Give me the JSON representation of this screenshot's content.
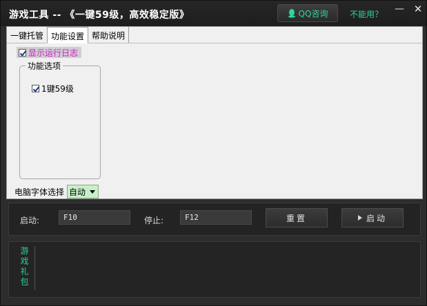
{
  "window": {
    "title": "游戏工具 -- 《一键59级，高效稳定版》",
    "qq_button": "QQ咨询",
    "unusable_link": "不能用？",
    "minimize_glyph": "—",
    "close_glyph": "✕"
  },
  "tabs": [
    {
      "label": "一键托管",
      "active": false
    },
    {
      "label": "功能设置",
      "active": true
    },
    {
      "label": "帮助说明",
      "active": false
    }
  ],
  "settings": {
    "show_log": {
      "label": "显示运行日志",
      "checked": true
    },
    "group_title": "功能选项",
    "option_one_key": {
      "label": "1键59级",
      "checked": true
    },
    "font_label": "电脑字体选择",
    "font_value": "自动"
  },
  "controls": {
    "start_label": "启动:",
    "start_key": "F10",
    "stop_label": "停止:",
    "stop_key": "F12",
    "reset_button": "重置",
    "start_button": "启动"
  },
  "gift": {
    "chars": [
      "游",
      "戏",
      "礼",
      "包"
    ]
  },
  "colors": {
    "accent": "#2fd3a0",
    "log_label": "#cc22cc",
    "font_select_bg": "#c8f0c8"
  }
}
